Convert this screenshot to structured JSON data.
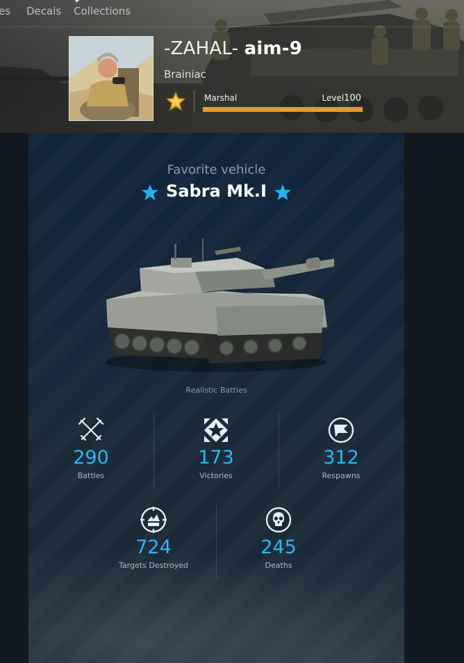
{
  "nav": {
    "tabs": [
      "es",
      "Decals",
      "Collections"
    ]
  },
  "profile": {
    "clan_tag": "-ZAHAL-",
    "nickname": "aim-9",
    "title": "Brainiac",
    "rank_name": "Marshal",
    "level_label": "Level",
    "level_value": "100",
    "xp_progress": 1.0,
    "avatar_icon": "tank-commander-portrait"
  },
  "favorite": {
    "label": "Favorite vehicle",
    "vehicle_name": "Sabra Mk.I",
    "mode": "Realistic Battles",
    "vehicle_icon": "tank-image"
  },
  "stats": [
    {
      "icon": "crossed-swords-icon",
      "value": "290",
      "label": "Battles"
    },
    {
      "icon": "victory-star-icon",
      "value": "173",
      "label": "Victories"
    },
    {
      "icon": "flag-icon",
      "value": "312",
      "label": "Respawns"
    },
    {
      "icon": "targets-destroyed-icon",
      "value": "724",
      "label": "Targets Destroyed"
    },
    {
      "icon": "skull-icon",
      "value": "245",
      "label": "Deaths"
    }
  ],
  "colors": {
    "accent_blue": "#2fb6ec",
    "xp_bar": "#e39a2e",
    "star_blue": "#22b4f0"
  }
}
